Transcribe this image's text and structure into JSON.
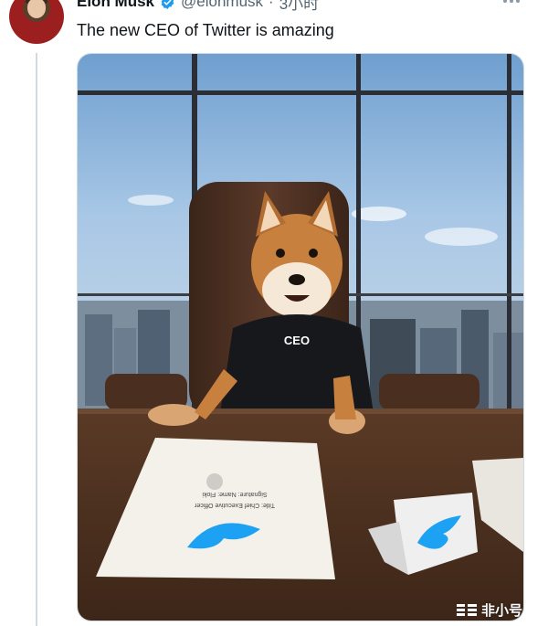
{
  "tweet": {
    "author": {
      "name": "Elon Musk",
      "handle": "@elonmusk",
      "verified": true
    },
    "separator": "·",
    "time": "3小时",
    "text": "The new CEO of Twitter is amazing",
    "media": {
      "sweater_text": "CEO",
      "document_text": "Signature: Name: Floki Title: Chief Executive Officer"
    }
  },
  "watermark": {
    "logo_text": "非小号"
  },
  "colors": {
    "verified": "#1d9bf0",
    "twitter_blue": "#1da1f2",
    "secondary_text": "#536471",
    "primary_text": "#0f1419"
  },
  "icons": {
    "verified": "verified-badge-icon",
    "more": "more-horizontal-icon",
    "twitter_bird": "twitter-bird-icon"
  }
}
